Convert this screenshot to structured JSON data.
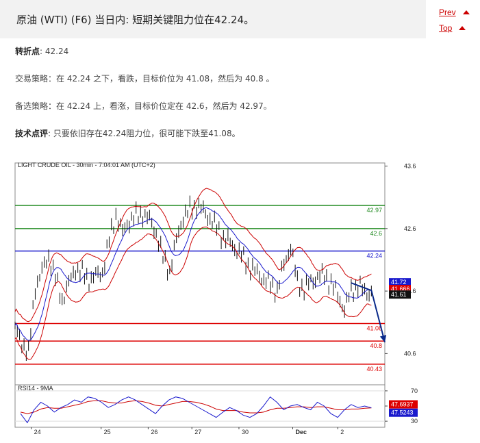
{
  "header": {
    "title": "原油 (WTI) (F6) 当日内: 短期关键阻力位在42.24。",
    "prev_label": "Prev",
    "top_label": "Top"
  },
  "analysis": {
    "pivot_label": "转折点",
    "pivot_value": ": 42.24",
    "strategy_label": "交易策略",
    "strategy_text": "：在 42.24 之下，看跌，目标价位为 41.08，然后为 40.8 。",
    "alt_label": "备选策略",
    "alt_text": "：在 42.24 上，看涨，目标价位定在 42.6，然后为 42.97。",
    "comment_label": "技术点评",
    "comment_text": ": 只要依旧存在42.24阻力位，很可能下跌至41.08。"
  },
  "chart_data": {
    "type": "line",
    "title": "LIGHT CRUDE OIL - 30min - 7:04:01 AM (UTC+2)",
    "x_ticks": [
      "24",
      "25",
      "26",
      "27",
      "30",
      "Dec",
      "2"
    ],
    "y_ticks": [
      43.6,
      42.6,
      41.6,
      40.6
    ],
    "ylim": [
      40.1,
      43.65
    ],
    "price_path": [
      [
        0,
        41.0
      ],
      [
        2,
        40.6
      ],
      [
        3,
        41.7
      ],
      [
        5,
        42.2
      ],
      [
        7,
        41.5
      ],
      [
        9,
        42.0
      ],
      [
        11,
        41.8
      ],
      [
        13,
        41.9
      ],
      [
        14,
        42.4
      ],
      [
        15,
        42.8
      ],
      [
        16,
        42.5
      ],
      [
        17,
        42.7
      ],
      [
        19,
        42.8
      ],
      [
        20,
        42.7
      ],
      [
        21,
        42.5
      ],
      [
        22,
        42.1
      ],
      [
        23,
        41.9
      ],
      [
        24,
        42.4
      ],
      [
        25,
        42.8
      ],
      [
        26,
        42.9
      ],
      [
        27,
        43.0
      ],
      [
        28,
        42.9
      ],
      [
        29,
        42.8
      ],
      [
        31,
        42.5
      ],
      [
        33,
        42.3
      ],
      [
        35,
        42.0
      ],
      [
        37,
        41.8
      ],
      [
        39,
        41.6
      ],
      [
        40,
        42.0
      ],
      [
        41,
        42.3
      ],
      [
        42,
        41.7
      ],
      [
        43,
        41.6
      ],
      [
        45,
        41.8
      ],
      [
        46,
        41.8
      ],
      [
        47,
        41.7
      ],
      [
        48,
        41.5
      ],
      [
        49,
        41.3
      ],
      [
        50,
        41.6
      ],
      [
        51,
        41.7
      ],
      [
        52,
        41.6
      ],
      [
        53,
        41.61
      ]
    ],
    "forecast_path": [
      [
        50,
        41.73
      ],
      [
        53,
        41.61
      ],
      [
        55,
        40.78
      ]
    ],
    "levels": [
      {
        "value": 42.97,
        "label": "42.97",
        "color": "#228b22"
      },
      {
        "value": 42.6,
        "label": "42.6",
        "color": "#228b22"
      },
      {
        "value": 42.24,
        "label": "42.24",
        "color": "#1a1acd"
      },
      {
        "value": 41.08,
        "label": "41.08",
        "color": "#dd0000"
      },
      {
        "value": 40.8,
        "label": "40.8",
        "color": "#dd0000"
      },
      {
        "value": 40.43,
        "label": "40.43",
        "color": "#dd0000"
      }
    ],
    "price_badges": [
      {
        "value": 41.72,
        "label": "41.72",
        "color": "#1a1acd"
      },
      {
        "value": 41.666,
        "label": "41.666",
        "color": "#dd0000"
      },
      {
        "value": 41.61,
        "label": "41.61",
        "color": "#111111"
      }
    ],
    "rsi": {
      "label": "RSI14 - 9MA",
      "y_ticks": [
        70,
        50,
        30
      ],
      "ylim": [
        22,
        78
      ],
      "rsi_badge": {
        "value": 47.6937,
        "label": "47.6937",
        "color": "#dd0000"
      },
      "ma_badge": {
        "value": 47.5243,
        "label": "47.5243",
        "color": "#1a1acd"
      },
      "rsi_values": [
        40,
        28,
        45,
        55,
        50,
        42,
        48,
        52,
        58,
        55,
        62,
        60,
        55,
        48,
        52,
        58,
        62,
        58,
        52,
        46,
        40,
        50,
        58,
        62,
        60,
        55,
        50,
        45,
        40,
        35,
        42,
        48,
        44,
        38,
        35,
        40,
        50,
        62,
        55,
        45,
        50,
        52,
        48,
        45,
        55,
        50,
        40,
        35,
        45,
        52,
        48,
        50,
        47.69
      ],
      "ma_values": [
        42,
        40,
        42,
        46,
        48,
        47,
        47,
        49,
        51,
        53,
        56,
        57,
        57,
        55,
        54,
        54,
        56,
        57,
        56,
        54,
        51,
        50,
        52,
        54,
        56,
        56,
        55,
        53,
        50,
        46,
        44,
        44,
        44,
        42,
        41,
        41,
        42,
        45,
        47,
        47,
        48,
        49,
        49,
        48,
        49,
        49,
        47,
        45,
        45,
        46,
        46,
        47,
        47.52
      ]
    }
  }
}
